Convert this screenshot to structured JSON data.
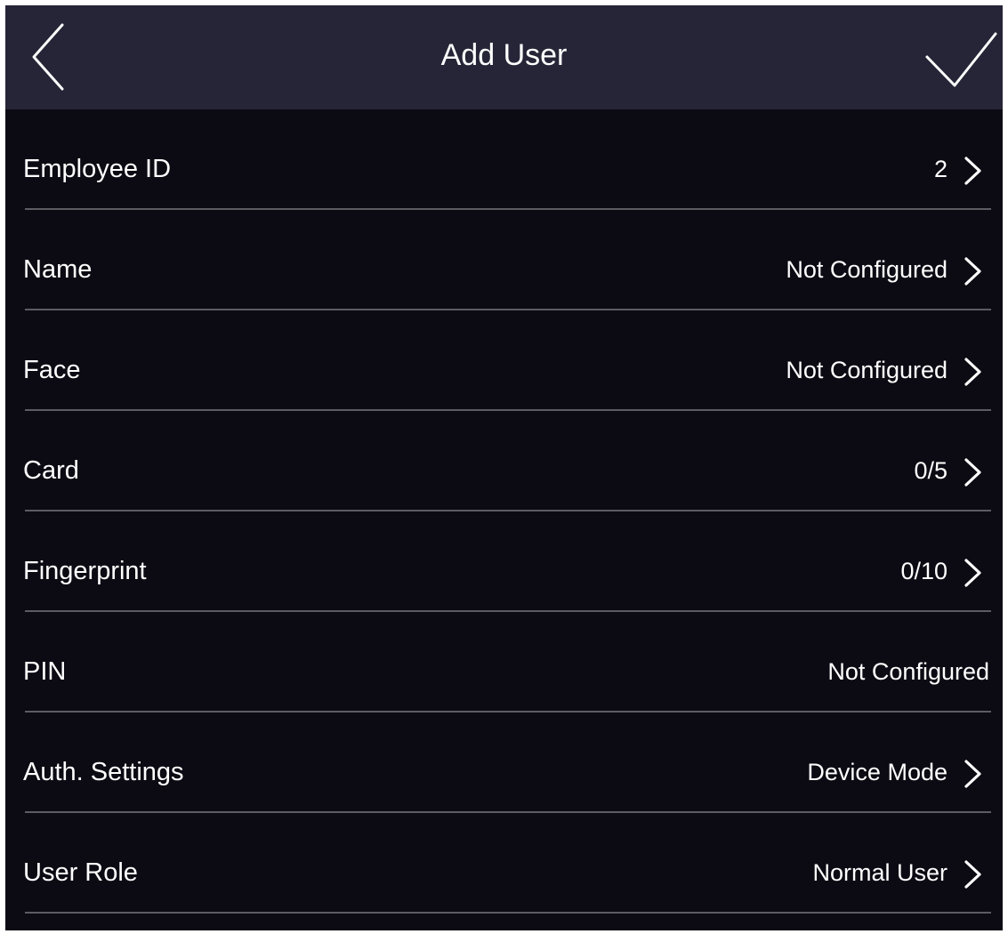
{
  "header": {
    "title": "Add User",
    "back_icon": "chevron-left-icon",
    "confirm_icon": "checkmark-icon"
  },
  "rows": [
    {
      "label": "Employee ID",
      "value": "2",
      "has_arrow": true
    },
    {
      "label": "Name",
      "value": "Not Configured",
      "has_arrow": true
    },
    {
      "label": "Face",
      "value": "Not Configured",
      "has_arrow": true
    },
    {
      "label": "Card",
      "value": "0/5",
      "has_arrow": true
    },
    {
      "label": "Fingerprint",
      "value": "0/10",
      "has_arrow": true
    },
    {
      "label": "PIN",
      "value": "Not Configured",
      "has_arrow": false
    },
    {
      "label": "Auth. Settings",
      "value": "Device Mode",
      "has_arrow": true
    },
    {
      "label": "User Role",
      "value": "Normal User",
      "has_arrow": true
    }
  ],
  "colors": {
    "header_bg": "#262537",
    "body_bg": "#0c0b13",
    "text": "#ffffff",
    "divider": "#5d5c63"
  }
}
